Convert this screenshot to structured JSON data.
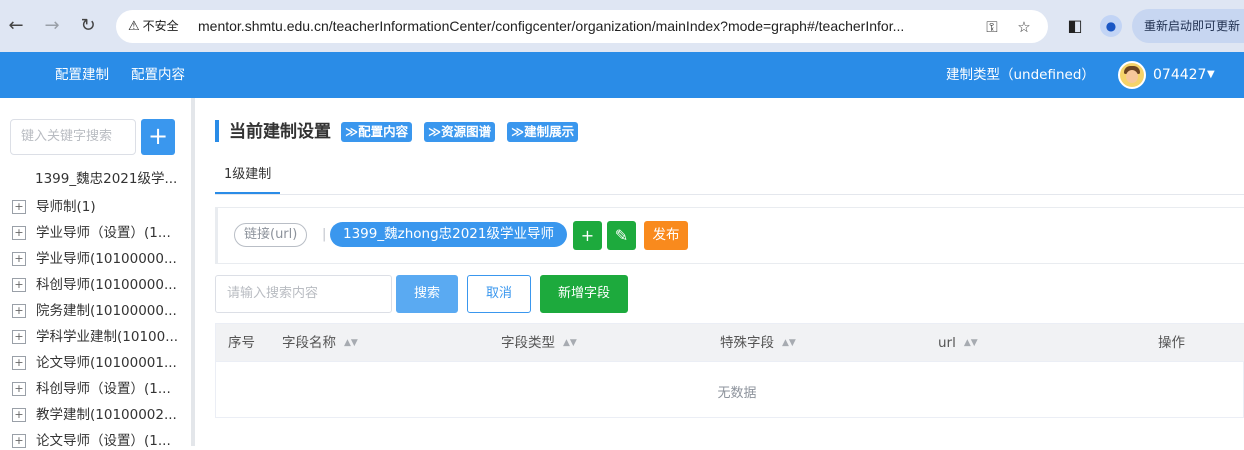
{
  "browser": {
    "security_label": "不安全",
    "url": "mentor.shmtu.edu.cn/teacherInformationCenter/configcenter/organization/mainIndex?mode=graph#/teacherInfor...",
    "restart_label": "重新启动即可更新"
  },
  "header": {
    "menu": [
      "配置建制",
      "配置内容"
    ],
    "type_label": "建制类型（undefined）",
    "user_id": "074427"
  },
  "sidebar": {
    "search_placeholder": "键入关键字搜索",
    "root_label": "1399_魏忠2021级学...",
    "items": [
      "导师制(1)",
      "学业导师（设置）(1...",
      "学业导师(10100000...",
      "科创导师(10100000...",
      "院务建制(10100000...",
      "学科学业建制(10100...",
      "论文导师(10100001...",
      "科创导师（设置）(1...",
      "教学建制(10100002...",
      "论文导师（设置）(1..."
    ]
  },
  "main": {
    "title": "当前建制设置",
    "chips": [
      "≫配置内容",
      "≫资源图谱",
      "≫建制展示"
    ],
    "tab": "1级建制",
    "link_pill": "链接(url)",
    "separator": "|",
    "name_pill": "1399_魏zhong忠2021级学业导师",
    "publish_label": "发布",
    "search_placeholder": "请输入搜索内容",
    "search_button": "搜索",
    "cancel_button": "取消",
    "add_field_button": "新增字段",
    "columns": [
      "序号",
      "字段名称",
      "字段类型",
      "特殊字段",
      "url",
      "操作"
    ],
    "empty_text": "无数据"
  }
}
